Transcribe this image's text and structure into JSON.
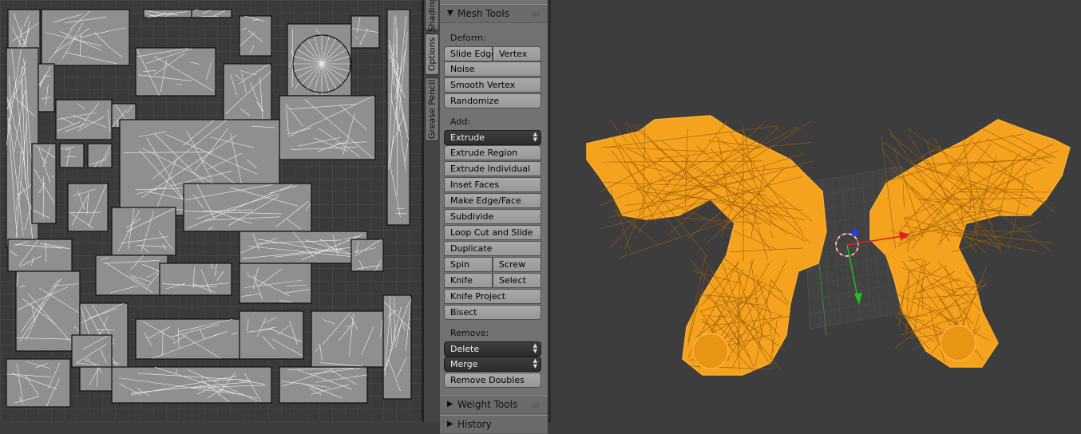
{
  "tabs": [
    {
      "label": "Shading"
    },
    {
      "label": "Options"
    },
    {
      "label": "Grease Pencil"
    }
  ],
  "mesh_tools": {
    "title": "Mesh Tools",
    "deform": {
      "label": "Deform:",
      "slide_edge": "Slide Edge",
      "vertex": "Vertex",
      "noise": "Noise",
      "smooth_vertex": "Smooth Vertex",
      "randomize": "Randomize"
    },
    "add": {
      "label": "Add:",
      "extrude": "Extrude",
      "extrude_region": "Extrude Region",
      "extrude_individual": "Extrude Individual",
      "inset_faces": "Inset Faces",
      "make_edge_face": "Make Edge/Face",
      "subdivide": "Subdivide",
      "loop_cut_and_slide": "Loop Cut and Slide",
      "duplicate": "Duplicate",
      "spin": "Spin",
      "screw": "Screw",
      "knife": "Knife",
      "select": "Select",
      "knife_project": "Knife Project",
      "bisect": "Bisect"
    },
    "remove": {
      "label": "Remove:",
      "delete": "Delete",
      "merge": "Merge",
      "remove_doubles": "Remove Doubles"
    }
  },
  "weight_tools": {
    "title": "Weight Tools"
  },
  "history": {
    "title": "History"
  },
  "colors": {
    "mesh_selected": "#f5a21e",
    "mesh_wire": "#ffae2a",
    "x_axis": "#e02020",
    "y_axis": "#20c020",
    "z_axis": "#2040ff",
    "panel_bg": "#727272"
  },
  "icons": {
    "collapse": "triangle-down-icon",
    "expand": "triangle-right-icon",
    "drag": "grip-icon",
    "dropdown": "updown-arrows-icon",
    "pivot": "3d-cursor-icon"
  }
}
